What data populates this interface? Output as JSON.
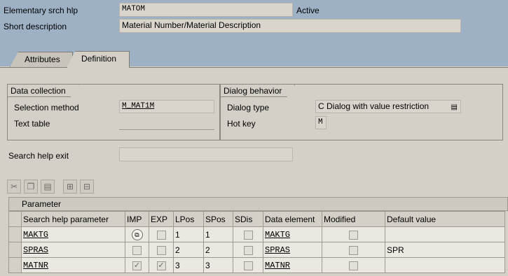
{
  "header": {
    "search_help_label": "Elementary srch hlp",
    "search_help_value": "MATOM",
    "status": "Active",
    "short_desc_label": "Short description",
    "short_desc_value": "Material Number/Material Description"
  },
  "tabs": [
    {
      "label": "Attributes",
      "active": false
    },
    {
      "label": "Definition",
      "active": true
    }
  ],
  "data_collection": {
    "title": "Data collection",
    "selection_method_label": "Selection method",
    "selection_method_value": "M_MAT1M",
    "text_table_label": "Text table",
    "text_table_value": ""
  },
  "dialog_behavior": {
    "title": "Dialog behavior",
    "dialog_type_label": "Dialog type",
    "dialog_type_value": "C Dialog with value restriction",
    "hot_key_label": "Hot key",
    "hot_key_value": "M"
  },
  "exit": {
    "label": "Search help exit",
    "value": ""
  },
  "toolbar": {
    "icons": [
      "cut-icon",
      "copy-icon",
      "paste-icon",
      "insert-row-icon",
      "delete-row-icon"
    ]
  },
  "parameters": {
    "title": "Parameter",
    "columns": [
      "Search help parameter",
      "IMP",
      "EXP",
      "LPos",
      "SPos",
      "SDis",
      "Data element",
      "Modified",
      "Default value"
    ],
    "rows": [
      {
        "param": "MAKTG",
        "imp": false,
        "exp": false,
        "lpos": "1",
        "spos": "1",
        "sdis": false,
        "data_element": "MAKTG",
        "modified": false,
        "default": ""
      },
      {
        "param": "SPRAS",
        "imp": false,
        "exp": false,
        "lpos": "2",
        "spos": "2",
        "sdis": false,
        "data_element": "SPRAS",
        "modified": false,
        "default": "SPR"
      },
      {
        "param": "MATNR",
        "imp": true,
        "exp": true,
        "lpos": "3",
        "spos": "3",
        "sdis": false,
        "data_element": "MATNR",
        "modified": false,
        "default": ""
      }
    ]
  }
}
